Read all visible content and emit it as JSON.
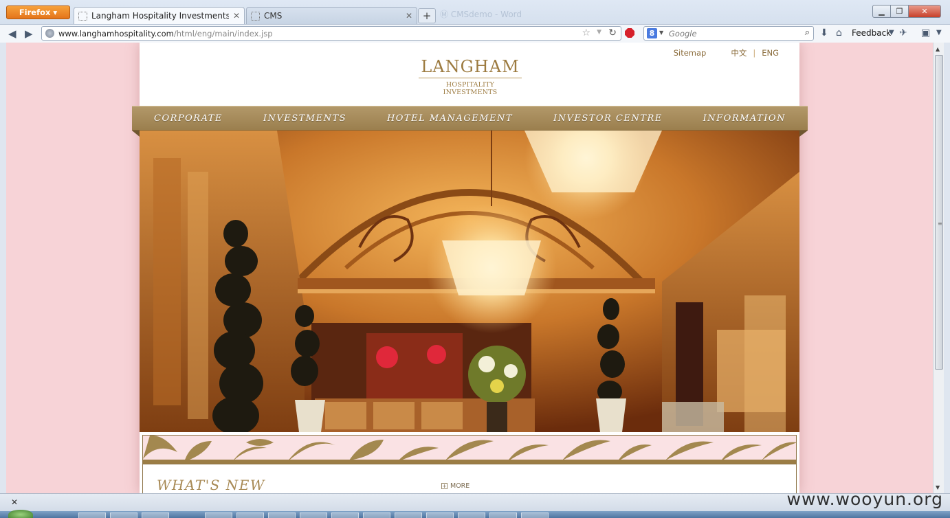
{
  "browser": {
    "app_button": "Firefox",
    "tabs": [
      {
        "title": "Langham Hospitality Investments Li...",
        "active": true
      },
      {
        "title": "CMS",
        "active": false
      }
    ],
    "background_title": "Ⓜ CMSdemo - Word",
    "url_host": "www.langhamhospitality.com",
    "url_path": "/html/eng/main/index.jsp",
    "search_engine_letter": "8",
    "search_placeholder": "Google",
    "feedback_label": "Feedback"
  },
  "page": {
    "top_links": {
      "sitemap": "Sitemap",
      "chinese": "中文",
      "english": "ENG"
    },
    "logo": {
      "name": "LANGHAM",
      "subtitle": "HOSPITALITY INVESTMENTS"
    },
    "nav": [
      "Corporate",
      "Investments",
      "Hotel Management",
      "Investor Centre",
      "Information"
    ],
    "section_title": "What's New",
    "more_label": "MORE"
  },
  "status": {
    "watermark": "www.wooyun.org"
  },
  "colors": {
    "gold": "#9b7f4e",
    "page_bg": "#f7d3d7",
    "damask_bg": "#fae2e4"
  }
}
